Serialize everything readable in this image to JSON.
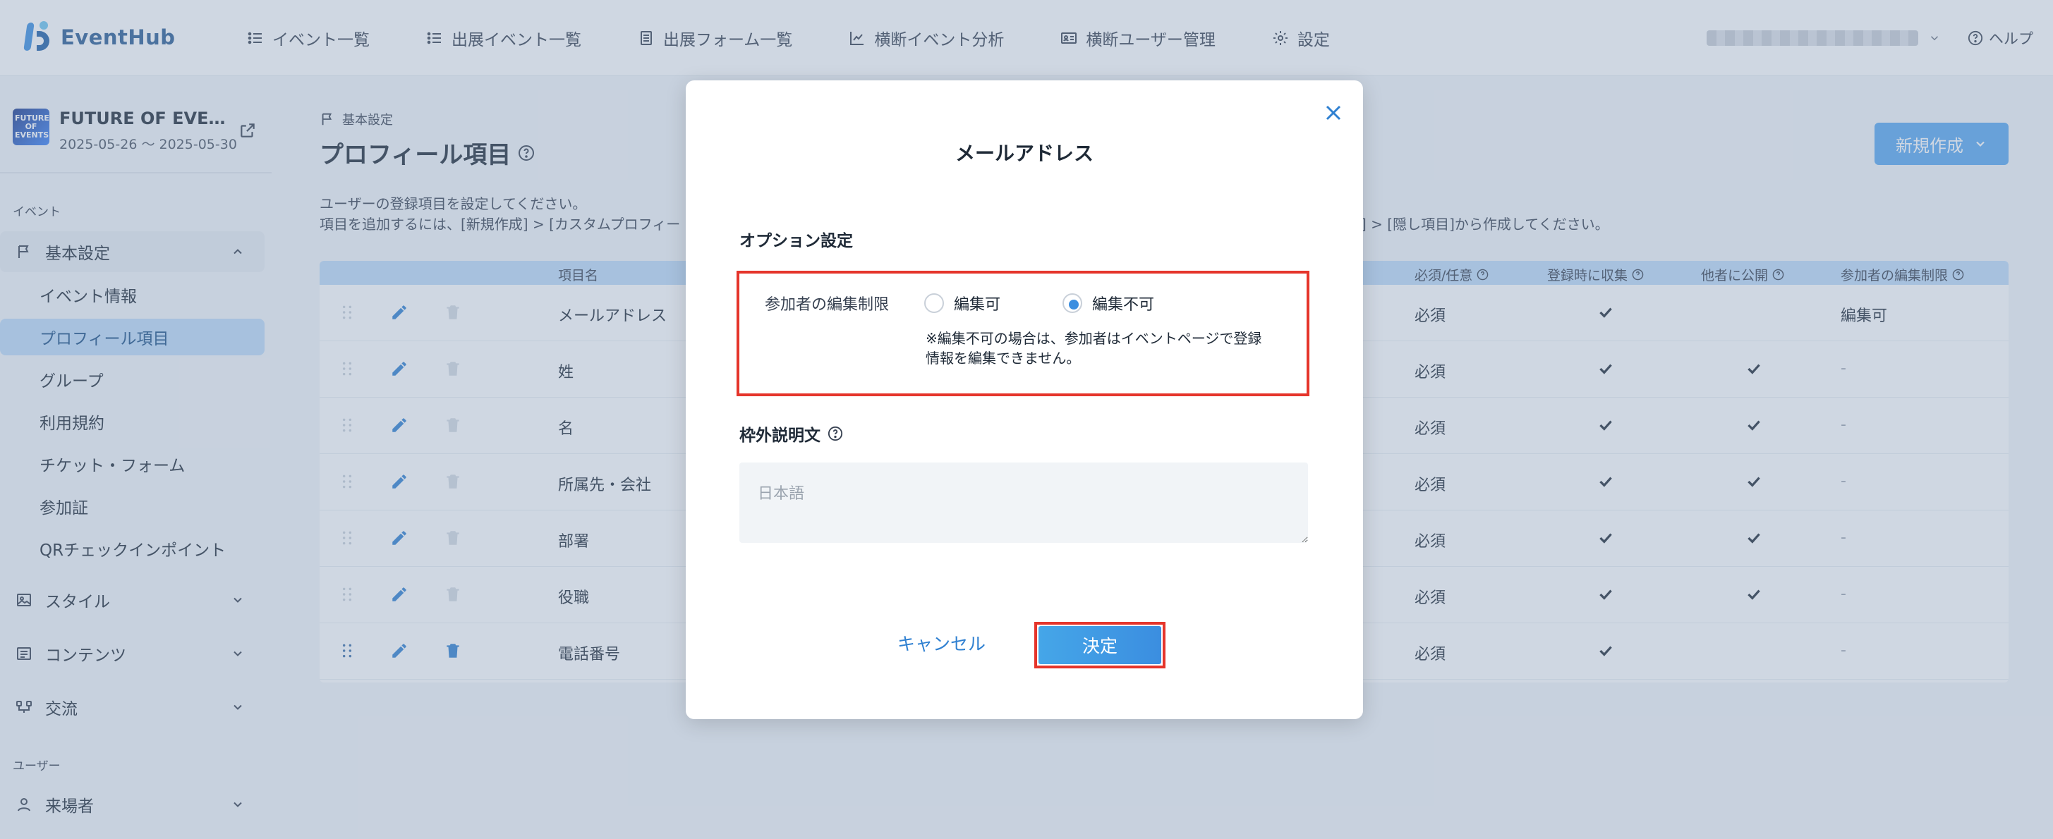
{
  "app": {
    "name": "EventHub"
  },
  "nav": [
    {
      "label": "イベント一覧",
      "icon": "list-icon"
    },
    {
      "label": "出展イベント一覧",
      "icon": "list-icon"
    },
    {
      "label": "出展フォーム一覧",
      "icon": "form-icon"
    },
    {
      "label": "横断イベント分析",
      "icon": "chart-icon"
    },
    {
      "label": "横断ユーザー管理",
      "icon": "id-card-icon"
    },
    {
      "label": "設定",
      "icon": "gear-icon"
    }
  ],
  "help_label": "ヘルプ",
  "event": {
    "thumb_text": "FUTURE OF EVENTS",
    "title": "FUTURE OF EVENTS",
    "date": "2025-05-26 〜 2025-05-30"
  },
  "sidebar": {
    "section_event": "イベント",
    "basic_settings": "基本設定",
    "sub_items": [
      "イベント情報",
      "プロフィール項目",
      "グループ",
      "利用規約",
      "チケット・フォーム",
      "参加証",
      "QRチェックインポイント"
    ],
    "style": "スタイル",
    "contents": "コンテンツ",
    "exchange": "交流",
    "section_user": "ユーザー",
    "visitors": "来場者"
  },
  "page": {
    "breadcrumb": "基本設定",
    "title": "プロフィール項目",
    "desc1": "ユーザーの登録項目を設定してください。",
    "desc2_left": "項目を追加するには、[新規作成] > [カスタムプロフィー",
    "desc2_right": "成] > [隠し項目]から作成してください。",
    "new_button": "新規作成"
  },
  "table": {
    "headers": {
      "name": "項目名",
      "required": "必須/任意",
      "collect": "登録時に収集",
      "public": "他者に公開",
      "edit_limit": "参加者の編集制限"
    },
    "rows": [
      {
        "name": "メールアドレス",
        "required": "必須",
        "collect": true,
        "public": false,
        "edit_limit": "編集可",
        "deletable": false
      },
      {
        "name": "姓",
        "required": "必須",
        "collect": true,
        "public": true,
        "edit_limit": "-",
        "deletable": false
      },
      {
        "name": "名",
        "required": "必須",
        "collect": true,
        "public": true,
        "edit_limit": "-",
        "deletable": false
      },
      {
        "name": "所属先・会社",
        "required": "必須",
        "collect": true,
        "public": true,
        "edit_limit": "-",
        "deletable": false
      },
      {
        "name": "部署",
        "required": "必須",
        "collect": true,
        "public": true,
        "edit_limit": "-",
        "deletable": false
      },
      {
        "name": "役職",
        "required": "必須",
        "collect": true,
        "public": true,
        "edit_limit": "-",
        "deletable": false
      },
      {
        "name": "電話番号",
        "required": "必須",
        "collect": true,
        "public": false,
        "edit_limit": "-",
        "deletable": true
      }
    ]
  },
  "modal": {
    "title": "メールアドレス",
    "option_section": "オプション設定",
    "edit_limit_label": "参加者の編集制限",
    "radio_editable": "編集可",
    "radio_not_editable": "編集不可",
    "selected": "編集不可",
    "note_line1": "※編集不可の場合は、参加者はイベントページで登録",
    "note_line2": "情報を編集できません。",
    "outside_desc_label": "枠外説明文",
    "textarea_placeholder": "日本語",
    "textarea_value": "",
    "cancel": "キャンセル",
    "ok": "決定"
  },
  "colors": {
    "accent": "#3b8ee0",
    "highlight": "#e5352b",
    "active_nav_bg": "#bfdcf8"
  }
}
